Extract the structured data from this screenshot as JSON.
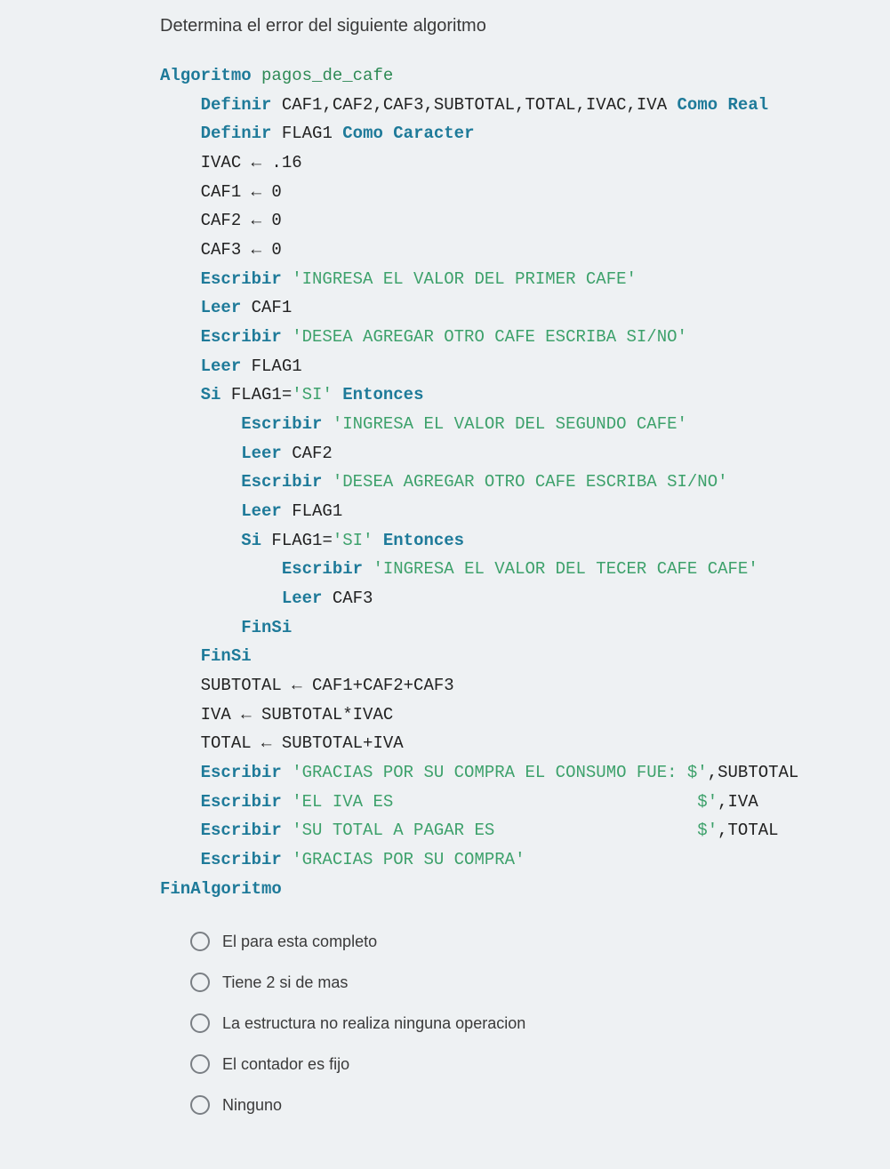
{
  "question": "Determina el error del siguiente algoritmo",
  "code": {
    "l1": {
      "kw": "Algoritmo",
      "name": " pagos_de_cafe"
    },
    "l2": {
      "kw": "Definir",
      "vars": " CAF1,CAF2,CAF3,SUBTOTAL,TOTAL,IVAC,IVA ",
      "kw2": "Como Real"
    },
    "l3": {
      "kw": "Definir",
      "vars": " FLAG1 ",
      "kw2": "Como Caracter"
    },
    "l4": {
      "t": "IVAC ← .16"
    },
    "l5": {
      "t": "CAF1 ← 0"
    },
    "l6": {
      "t": "CAF2 ← 0"
    },
    "l7": {
      "t": "CAF3 ← 0"
    },
    "l8": {
      "kw": "Escribir",
      "str": " 'INGRESA EL VALOR DEL PRIMER CAFE'"
    },
    "l9": {
      "kw": "Leer",
      "vars": " CAF1"
    },
    "l10": {
      "kw": "Escribir",
      "str": " 'DESEA AGREGAR OTRO CAFE ESCRIBA SI/NO'"
    },
    "l11": {
      "kw": "Leer",
      "vars": " FLAG1"
    },
    "l12": {
      "kw": "Si",
      "mid": " FLAG1=",
      "str": "'SI'",
      "kw2": " Entonces"
    },
    "l13": {
      "kw": "Escribir",
      "str": " 'INGRESA EL VALOR DEL SEGUNDO CAFE'"
    },
    "l14": {
      "kw": "Leer",
      "vars": " CAF2"
    },
    "l15": {
      "kw": "Escribir",
      "str": " 'DESEA AGREGAR OTRO CAFE ESCRIBA SI/NO'"
    },
    "l16": {
      "kw": "Leer",
      "vars": " FLAG1"
    },
    "l17": {
      "kw": "Si",
      "mid": " FLAG1=",
      "str": "'SI'",
      "kw2": " Entonces"
    },
    "l18": {
      "kw": "Escribir",
      "str": " 'INGRESA EL VALOR DEL TECER CAFE CAFE'"
    },
    "l19": {
      "kw": "Leer",
      "vars": " CAF3"
    },
    "l20": {
      "kw": "FinSi"
    },
    "l21": {
      "kw": "FinSi"
    },
    "l22": {
      "t": "SUBTOTAL ← CAF1+CAF2+CAF3"
    },
    "l23": {
      "t": "IVA ← SUBTOTAL*IVAC"
    },
    "l24": {
      "t": "TOTAL ← SUBTOTAL+IVA"
    },
    "l25": {
      "kw": "Escribir",
      "str": " 'GRACIAS POR SU COMPRA EL CONSUMO FUE: $'",
      "tail": ",SUBTOTAL"
    },
    "l26": {
      "kw": "Escribir",
      "str": " 'EL IVA ES                              $'",
      "tail": ",IVA"
    },
    "l27": {
      "kw": "Escribir",
      "str": " 'SU TOTAL A PAGAR ES                    $'",
      "tail": ",TOTAL"
    },
    "l28": {
      "kw": "Escribir",
      "str": " 'GRACIAS POR SU COMPRA'"
    },
    "l29": {
      "kw": "FinAlgoritmo"
    }
  },
  "options": [
    "El para esta completo",
    "Tiene 2 si de mas",
    "La estructura no realiza ninguna operacion",
    "El contador es fijo",
    "Ninguno"
  ]
}
